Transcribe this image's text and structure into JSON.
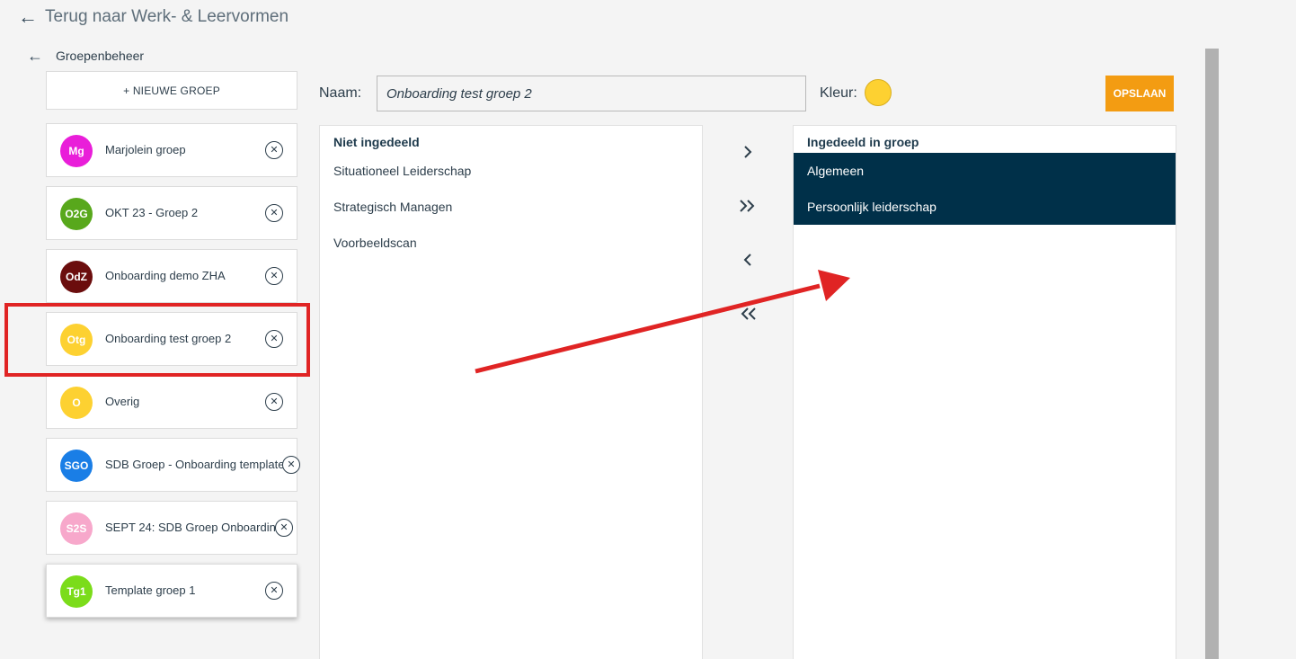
{
  "nav": {
    "back_top_label": "Terug naar Werk- & Leervormen",
    "back_sub_label": "Groepenbeheer"
  },
  "sidebar": {
    "new_group_label": "+ NIEUWE GROEP",
    "groups": [
      {
        "initials": "Mg",
        "name": "Marjolein groep",
        "color": "#e91ed9"
      },
      {
        "initials": "O2G",
        "name": "OKT 23 - Groep 2",
        "color": "#58a81c"
      },
      {
        "initials": "OdZ",
        "name": "Onboarding demo ZHA",
        "color": "#6b0d0d"
      },
      {
        "initials": "Otg",
        "name": "Onboarding test groep 2",
        "color": "#fdd131"
      },
      {
        "initials": "O",
        "name": "Overig",
        "color": "#fdd131"
      },
      {
        "initials": "SGO",
        "name": "SDB Groep - Onboarding template",
        "color": "#1a7ee6"
      },
      {
        "initials": "S2S",
        "name": "SEPT 24: SDB Groep Onboarding",
        "color": "#f7a8cb"
      },
      {
        "initials": "Tg1",
        "name": "Template groep 1",
        "color": "#7bdc1a"
      }
    ]
  },
  "form": {
    "name_label": "Naam:",
    "name_value": "Onboarding test groep 2",
    "color_label": "Kleur:",
    "color_value": "#fdd131",
    "save_label": "OPSLAAN"
  },
  "unassigned": {
    "title": "Niet ingedeeld",
    "items": [
      "Situationeel Leiderschap",
      "Strategisch Managen",
      "Voorbeeldscan"
    ]
  },
  "assigned": {
    "title": "Ingedeeld in groep",
    "items": [
      "Algemeen",
      "Persoonlijk leiderschap"
    ]
  },
  "transfer_buttons": [
    "chevron-right-icon",
    "double-chevron-right-icon",
    "chevron-left-icon",
    "double-chevron-left-icon"
  ],
  "colors": {
    "accent": "#f39c12",
    "selected": "#003049",
    "annotation": "#e02424"
  }
}
